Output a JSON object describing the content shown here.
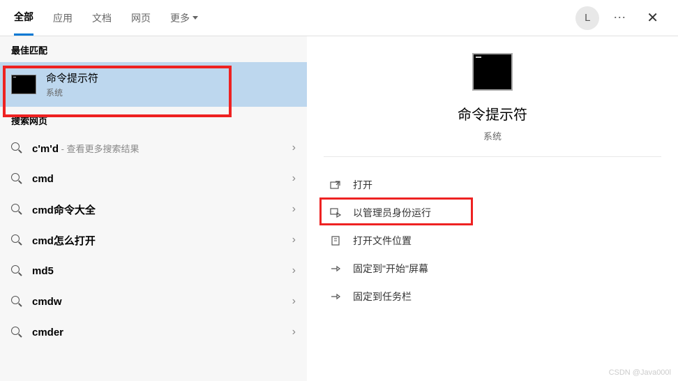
{
  "header": {
    "tabs": [
      "全部",
      "应用",
      "文档",
      "网页",
      "更多"
    ],
    "avatar_initial": "L"
  },
  "best_match": {
    "section_label": "最佳匹配",
    "title": "命令提示符",
    "subtitle": "系统"
  },
  "web_search": {
    "section_label": "搜索网页",
    "items": [
      {
        "term": "c'm'd",
        "hint": " - 查看更多搜索结果"
      },
      {
        "term": "cmd",
        "hint": ""
      },
      {
        "term": "cmd命令大全",
        "hint": ""
      },
      {
        "term": "cmd怎么打开",
        "hint": ""
      },
      {
        "term": "md5",
        "hint": ""
      },
      {
        "term": "cmdw",
        "hint": ""
      },
      {
        "term": "cmder",
        "hint": ""
      }
    ]
  },
  "preview": {
    "title": "命令提示符",
    "subtitle": "系统"
  },
  "actions": {
    "open": "打开",
    "run_admin": "以管理员身份运行",
    "open_location": "打开文件位置",
    "pin_start": "固定到\"开始\"屏幕",
    "pin_taskbar": "固定到任务栏"
  },
  "watermark": "CSDN @Java000l"
}
